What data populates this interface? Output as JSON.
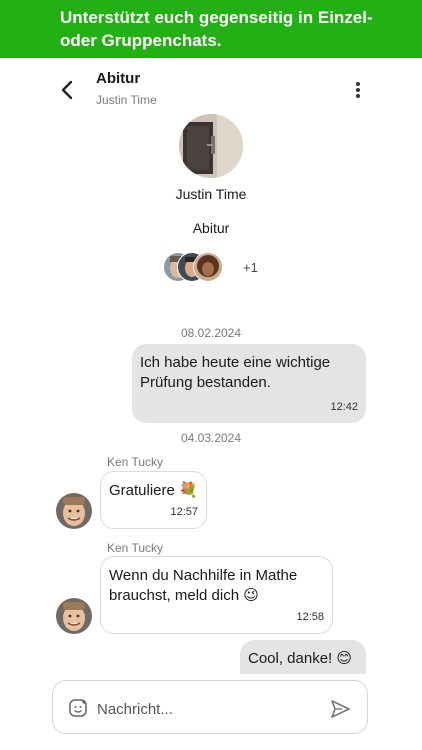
{
  "banner": {
    "line1": "Unterstützt euch gegenseitig in Einzel-",
    "line2": "oder Gruppenchats."
  },
  "header": {
    "title": "Abitur",
    "subtitle": "Justin Time"
  },
  "group": {
    "owner_name": "Justin Time",
    "name": "Abitur",
    "extra_members": "+1"
  },
  "messages": [
    {
      "date": "08.02.2024"
    },
    {
      "direction": "out",
      "text": "Ich habe heute eine wichtige\nPrüfung bestanden.",
      "time": "12:42"
    },
    {
      "date": "04.03.2024"
    },
    {
      "direction": "in",
      "sender": "Ken Tucky",
      "text": "Gratuliere 💐",
      "time": "12:57"
    },
    {
      "direction": "in",
      "sender": "Ken Tucky",
      "text": "Wenn du Nachhilfe in Mathe\nbrauchst, meld dich 😉",
      "time": "12:58"
    },
    {
      "direction": "out",
      "text": "Cool, danke! 😊"
    }
  ],
  "composer": {
    "placeholder": "Nachricht..."
  },
  "colors": {
    "brand_green": "#22b014",
    "outgoing_bubble": "#e4e4e4",
    "caret": "#21b3a3"
  },
  "icons": [
    "back-arrow-icon",
    "more-vert-icon",
    "sticker-icon",
    "send-icon"
  ]
}
